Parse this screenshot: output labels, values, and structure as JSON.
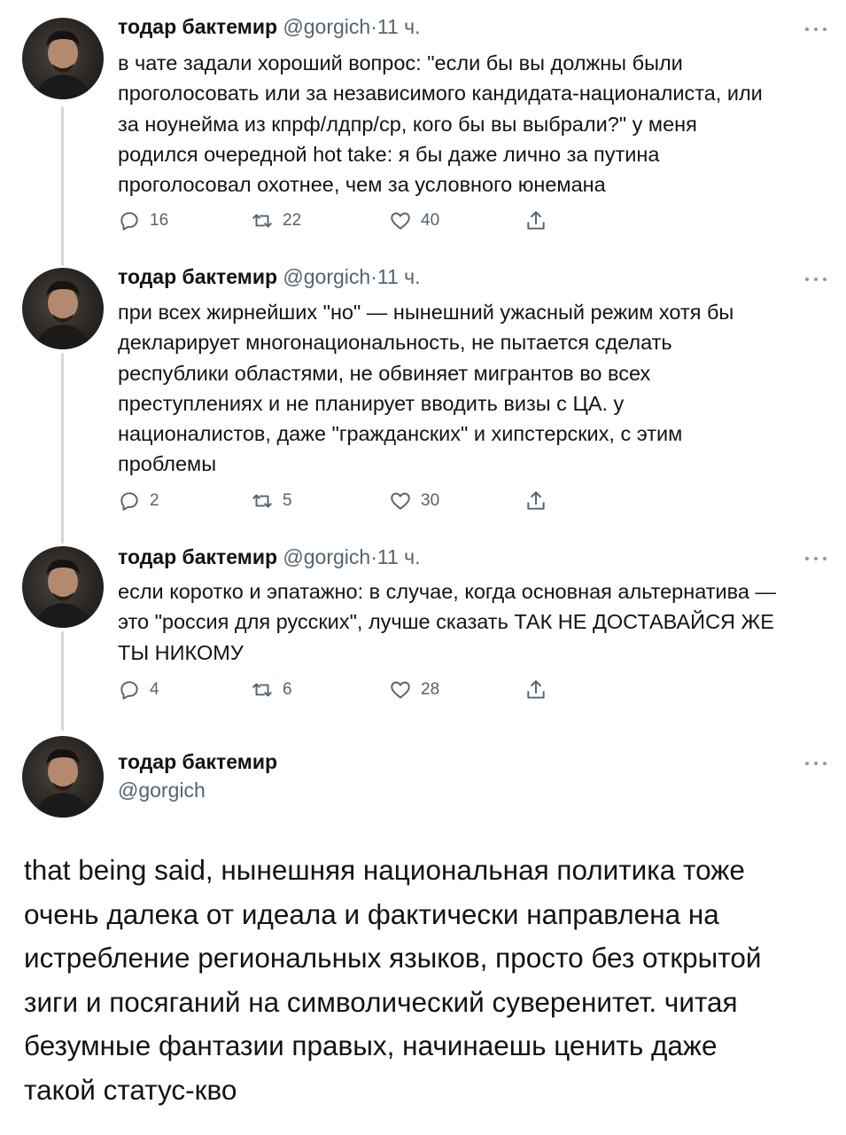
{
  "tweets": [
    {
      "name": "тодар бактемир",
      "handle": "@gorgich",
      "separator": "·",
      "time": "11 ч.",
      "text": "в чате задали хороший вопрос: \"если бы вы должны были\nпроголосовать или за независимого кандидата-националиста, или\nза ноунейма из кпрф/лдпр/ср, кого бы вы выбрали?\" у меня\nродился очередной hot take: я бы даже лично за путина\nпроголосовал охотнее, чем за условного юнемана",
      "replies": "16",
      "retweets": "22",
      "likes": "40"
    },
    {
      "name": "тодар бактемир",
      "handle": "@gorgich",
      "separator": "·",
      "time": "11 ч.",
      "text": "при всех жирнейших \"но\" — нынешний ужасный режим хотя бы\nдекларирует многонациональность, не пытается сделать\nреспублики областями, не обвиняет мигрантов во всех\nпреступлениях и не планирует вводить визы с ЦА. у\nнационалистов, даже \"гражданских\" и хипстерских, с этим\nпроблемы",
      "replies": "2",
      "retweets": "5",
      "likes": "30"
    },
    {
      "name": "тодар бактемир",
      "handle": "@gorgich",
      "separator": "·",
      "time": "11 ч.",
      "text": "если коротко и эпатажно: в случае, когда основная альтернатива —\nэто \"россия для русских\", лучше сказать ТАК НЕ ДОСТАВАЙСЯ ЖЕ\nТЫ НИКОМУ",
      "replies": "4",
      "retweets": "6",
      "likes": "28"
    }
  ],
  "focal": {
    "name": "тодар бактемир",
    "handle": "@gorgich",
    "text": "that being said, нынешняя национальная политика тоже\nочень далека от идеала и фактически направлена на\nистребление региональных языков, просто без открытой\nзиги и посяганий на символический суверенитет. читая\nбезумные фантазии правых, начинаешь ценить даже\nтакой статус-кво"
  },
  "icons": {
    "reply": "reply-icon",
    "retweet": "retweet-icon",
    "like": "heart-icon",
    "share": "share-icon",
    "more": "more-icon"
  },
  "colors": {
    "text": "#0f1419",
    "secondary": "#536471",
    "thread_line": "#cfd9de"
  }
}
